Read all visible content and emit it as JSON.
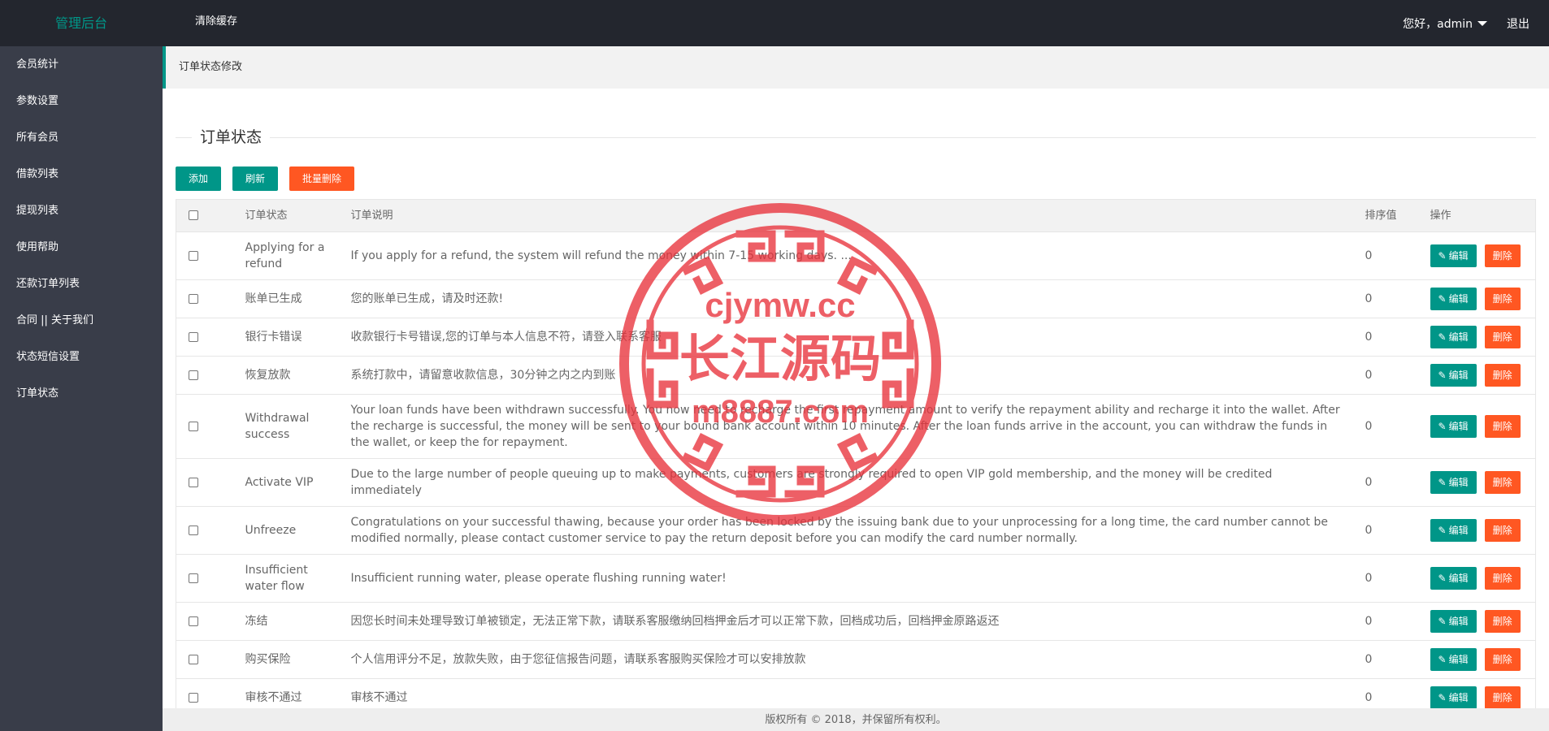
{
  "header": {
    "logo": "管理后台",
    "clear_cache": "清除缓存",
    "greeting": "您好，admin",
    "logout": "退出"
  },
  "sidebar": {
    "items": [
      {
        "label": "会员统计"
      },
      {
        "label": "参数设置"
      },
      {
        "label": "所有会员"
      },
      {
        "label": "借款列表"
      },
      {
        "label": "提现列表"
      },
      {
        "label": "使用帮助"
      },
      {
        "label": "还款订单列表"
      },
      {
        "label": "合同 || 关于我们"
      },
      {
        "label": "状态短信设置"
      },
      {
        "label": "订单状态"
      }
    ]
  },
  "breadcrumb": "订单状态修改",
  "section_title": "订单状态",
  "toolbar": {
    "add": "添加",
    "refresh": "刷新",
    "batch_delete": "批量删除"
  },
  "table": {
    "headers": {
      "status": "订单状态",
      "description": "订单说明",
      "sort": "排序值",
      "ops": "操作"
    },
    "edit_label": "编辑",
    "delete_label": "删除",
    "rows": [
      {
        "status": "Applying for a refund",
        "description": "If you apply for a refund, the system will refund the money within 7-15 working days. ...",
        "sort": "0"
      },
      {
        "status": "账单已生成",
        "description": "您的账单已生成，请及时还款!",
        "sort": "0"
      },
      {
        "status": "银行卡错误",
        "description": "收款银行卡号错误,您的订单与本人信息不符，请登入联系客服",
        "sort": "0"
      },
      {
        "status": "恢复放款",
        "description": "系统打款中，请留意收款信息，30分钟之内之内到账",
        "sort": "0"
      },
      {
        "status": "Withdrawal success",
        "description": "Your loan funds have been withdrawn successfully. You now need to recharge the first repayment amount to verify the repayment ability and recharge it into the wallet. After the recharge is successful, the money will be sent to your bound bank account within 10 minutes. After the loan funds arrive in the account, you can withdraw the funds in the wallet, or keep the for repayment.",
        "sort": "0"
      },
      {
        "status": "Activate VIP",
        "description": "Due to the large number of people queuing up to make payments, customers are strongly required to open VIP gold membership, and the money will be credited immediately",
        "sort": "0"
      },
      {
        "status": "Unfreeze",
        "description": "Congratulations on your successful thawing, because your order has been locked by the issuing bank due to your unprocessing for a long time, the card number cannot be modified normally, please contact customer service to pay the return deposit before you can modify the card number normally.",
        "sort": "0"
      },
      {
        "status": "Insufficient water flow",
        "description": "Insufficient running water, please operate flushing running water!",
        "sort": "0"
      },
      {
        "status": "冻结",
        "description": "因您长时间未处理导致订单被锁定，无法正常下款，请联系客服缴纳回档押金后才可以正常下款，回档成功后，回档押金原路返还",
        "sort": "0"
      },
      {
        "status": "购买保险",
        "description": "个人信用评分不足，放款失败，由于您征信报告问题，请联系客服购买保险才可以安排放款",
        "sort": "0"
      },
      {
        "status": "审核不通过",
        "description": "审核不通过",
        "sort": "0"
      }
    ]
  },
  "footer": "版权所有 © 2018，并保留所有权利。",
  "watermark": {
    "line1": "cjymw.cc",
    "line2": "长江源码",
    "line3": "m8887.com",
    "color": "#e8333c"
  },
  "colors": {
    "accent": "#009688",
    "danger": "#ff5722",
    "header_bg": "#23262e",
    "sidebar_bg": "#393d49"
  }
}
